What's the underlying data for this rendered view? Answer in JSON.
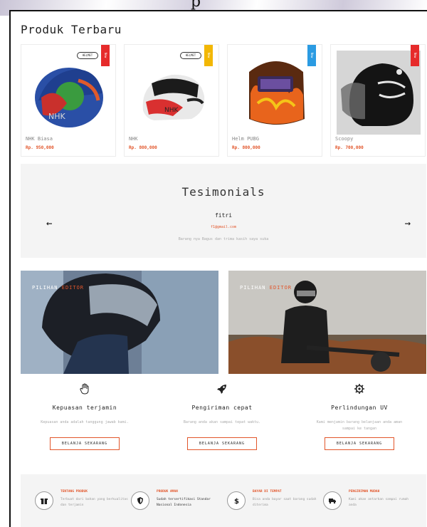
{
  "header": {
    "partial_word": "p"
  },
  "section_title": "Produk Terbaru",
  "products": [
    {
      "name": "NHK Biasa",
      "price": "Rp. 950,000",
      "ribbon": "New",
      "ribbon_color": "#e62b2b",
      "logo": "HELMET"
    },
    {
      "name": "NHK",
      "price": "Rp. 800,000",
      "ribbon": "New",
      "ribbon_color": "#f2b705",
      "logo": "HELMET"
    },
    {
      "name": "Helm PUBG",
      "price": "Rp. 800,000",
      "ribbon": "New",
      "ribbon_color": "#2b9be2"
    },
    {
      "name": "Scoopy",
      "price": "Rp. 700,000",
      "ribbon": "New",
      "ribbon_color": "#e62b2b"
    }
  ],
  "testimonials": {
    "title": "Tesimonials",
    "name": "fitri",
    "email": "f1@gmail.com",
    "text": "Barang nya Bagus dan trima kasih saya suka"
  },
  "banners": [
    {
      "label_a": "PILIHAN",
      "label_b": "EDITOR"
    },
    {
      "label_a": "PILIHAN",
      "label_b": "EDITOR"
    }
  ],
  "features": [
    {
      "icon": "hand-icon",
      "title": "Kepuasan terjamin",
      "desc": "Kepuasan anda adalah tanggung jawab kami.",
      "button": "BELANJA SEKARANG"
    },
    {
      "icon": "rocket-icon",
      "title": "Pengiriman cepat",
      "desc": "Barang anda akan sampai tepat waktu.",
      "button": "BELANJA SEKARANG"
    },
    {
      "icon": "gear-icon",
      "title": "Perlindungan UV",
      "desc": "Kami menjamin barang belanjaan anda aman sampai ke tangan",
      "button": "BELANJA SEKARANG"
    }
  ],
  "services": [
    {
      "icon": "gift-icon",
      "title": "TENTANG PRODUK",
      "desc": "Terbuat dari bahan yang berkualitas dan terjamin"
    },
    {
      "icon": "shield-icon",
      "title": "PRODUK AMAN",
      "desc": "Sudah tersertifikasi Standar Nasional Indonesia"
    },
    {
      "icon": "dollar-icon",
      "title": "BAYAR DI TEMPAT",
      "desc": "Bisa anda bayar saat barang sudah diterima"
    },
    {
      "icon": "truck-icon",
      "title": "PENGIRIMAN MUDAH",
      "desc": "Kami akan antarkan sampai rumah anda"
    }
  ],
  "colors": {
    "accent": "#e2562b",
    "panel": "#f4f4f4"
  }
}
